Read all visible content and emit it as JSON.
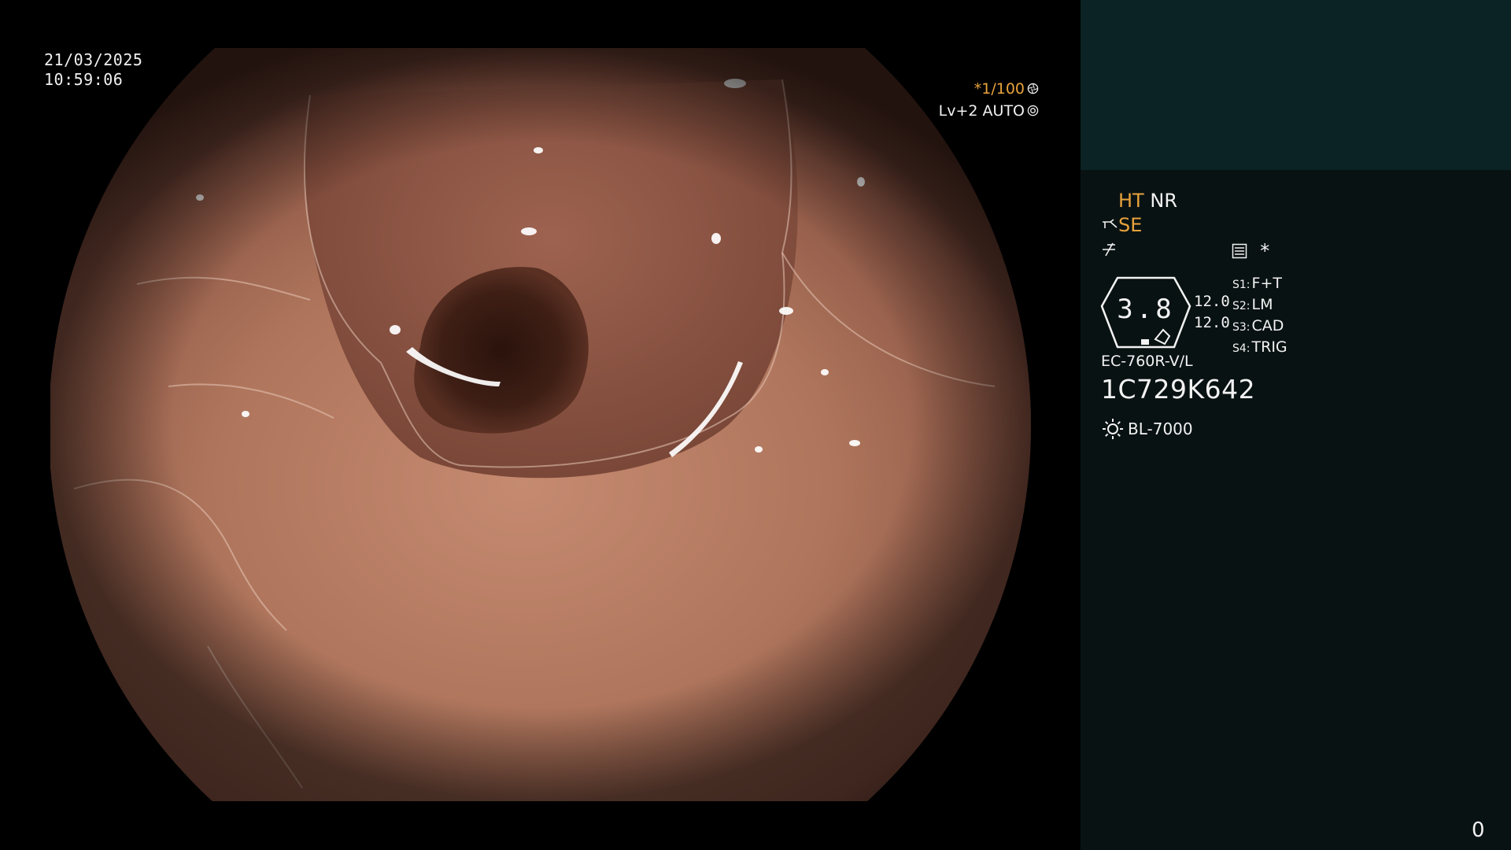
{
  "overlay": {
    "date": "21/03/2025",
    "time": "10:59:06",
    "shutter": "*1/100",
    "level": "Lv+2 AUTO"
  },
  "panel": {
    "status_row1_a": "HT",
    "status_row1_b": "NR",
    "status_row2": "SE",
    "star": "*",
    "gauge_value": "3.8",
    "readings": [
      "12.0",
      "12.0"
    ],
    "switches": [
      {
        "key": "S1:",
        "value": "F+T"
      },
      {
        "key": "S2:",
        "value": "LM"
      },
      {
        "key": "S3:",
        "value": "CAD"
      },
      {
        "key": "S4:",
        "value": "TRIG"
      }
    ],
    "scope_model": "EC-760R-V/L",
    "scope_serial": "1C729K642",
    "light_source": "BL-7000",
    "counter": "0"
  },
  "colors": {
    "accent": "#e8a33c",
    "panel_header": "#0b2324",
    "panel_body": "#091213"
  },
  "icons": [
    "aperture-icon",
    "iris-icon",
    "scope-tip-icon",
    "signal-icon",
    "menu-icon",
    "gauge-icon",
    "sun-icon"
  ]
}
